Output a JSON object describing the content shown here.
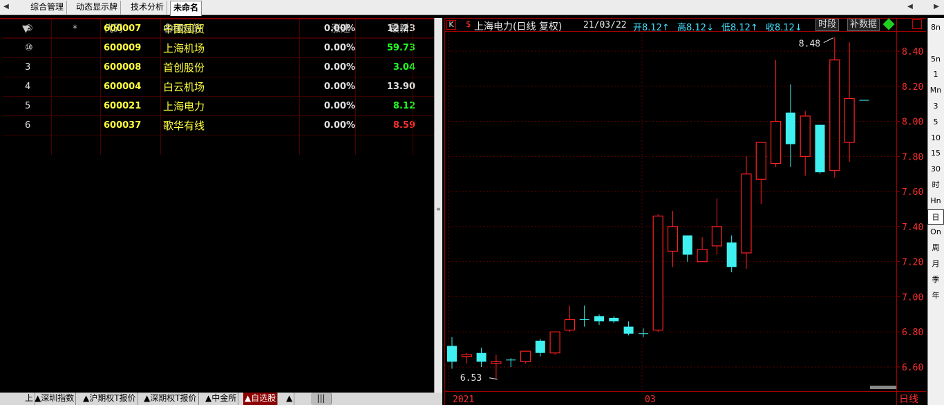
{
  "tabs": [
    "综合管理",
    "动态显示牌",
    "技术分析",
    "未命名"
  ],
  "list": {
    "headers": [
      "▼",
      "*",
      "代码",
      "名称对的",
      "涨速",
      "最新"
    ],
    "rows": [
      {
        "idx": "⑤",
        "code": "600007",
        "name": "中国国贸",
        "speed": "0.00%",
        "price": "12.23",
        "pc": "#e0e0e0"
      },
      {
        "idx": "⑩",
        "code": "600009",
        "name": "上海机场",
        "speed": "0.00%",
        "price": "59.73",
        "pc": "#20ff20"
      },
      {
        "idx": "3",
        "code": "600008",
        "name": "首创股份",
        "speed": "0.00%",
        "price": "3.04",
        "pc": "#20ff20"
      },
      {
        "idx": "4",
        "code": "600004",
        "name": "白云机场",
        "speed": "0.00%",
        "price": "13.90",
        "pc": "#e0e0e0"
      },
      {
        "idx": "5",
        "code": "600021",
        "name": "上海电力",
        "speed": "0.00%",
        "price": "8.12",
        "pc": "#20ff20"
      },
      {
        "idx": "6",
        "code": "600037",
        "name": "歌华有线",
        "speed": "0.00%",
        "price": "8.59",
        "pc": "#ff3030"
      }
    ]
  },
  "bottom_tabs": [
    "上",
    "▲深圳指数",
    "▲沪期权T报价",
    "▲深期权T报价",
    "▲中金所",
    "▲自选股",
    "▲",
    "|||"
  ],
  "chart_header": {
    "k": "K",
    "s": "$",
    "title": "上海电力(日线 复权)",
    "date": "21/03/22",
    "open": "开8.12↑",
    "high": "高8.12↓",
    "low": "低8.12↑",
    "close": "收8.12↓",
    "btn_time": "时段",
    "btn_data": "补数据"
  },
  "chart_data": {
    "type": "candlestick",
    "ylim": [
      6.53,
      8.5
    ],
    "yticks": [
      "8.40",
      "8.20",
      "8.00",
      "7.80",
      "7.60",
      "7.40",
      "7.20",
      "7.00",
      "6.80",
      "6.60"
    ],
    "xlabels": [
      "2021",
      "03"
    ],
    "period_label": "日线",
    "annotations": {
      "max": "8.48",
      "min": "6.53"
    },
    "candles": [
      {
        "o": 6.72,
        "h": 6.77,
        "l": 6.59,
        "c": 6.63
      },
      {
        "o": 6.66,
        "h": 6.68,
        "l": 6.62,
        "c": 6.67
      },
      {
        "o": 6.68,
        "h": 6.71,
        "l": 6.6,
        "c": 6.63
      },
      {
        "o": 6.62,
        "h": 6.67,
        "l": 6.53,
        "c": 6.63
      },
      {
        "o": 6.64,
        "h": 6.65,
        "l": 6.6,
        "c": 6.64
      },
      {
        "o": 6.63,
        "h": 6.69,
        "l": 6.62,
        "c": 6.69
      },
      {
        "o": 6.75,
        "h": 6.76,
        "l": 6.66,
        "c": 6.68
      },
      {
        "o": 6.68,
        "h": 6.8,
        "l": 6.67,
        "c": 6.8
      },
      {
        "o": 6.81,
        "h": 6.95,
        "l": 6.8,
        "c": 6.87
      },
      {
        "o": 6.87,
        "h": 6.95,
        "l": 6.83,
        "c": 6.87
      },
      {
        "o": 6.89,
        "h": 6.9,
        "l": 6.84,
        "c": 6.86
      },
      {
        "o": 6.88,
        "h": 6.89,
        "l": 6.85,
        "c": 6.86
      },
      {
        "o": 6.83,
        "h": 6.86,
        "l": 6.78,
        "c": 6.79
      },
      {
        "o": 6.79,
        "h": 6.82,
        "l": 6.77,
        "c": 6.79
      },
      {
        "o": 6.81,
        "h": 7.47,
        "l": 6.8,
        "c": 7.46
      },
      {
        "o": 7.26,
        "h": 7.49,
        "l": 7.17,
        "c": 7.4
      },
      {
        "o": 7.35,
        "h": 7.35,
        "l": 7.2,
        "c": 7.24
      },
      {
        "o": 7.2,
        "h": 7.34,
        "l": 7.2,
        "c": 7.27
      },
      {
        "o": 7.29,
        "h": 7.56,
        "l": 7.24,
        "c": 7.4
      },
      {
        "o": 7.31,
        "h": 7.35,
        "l": 7.14,
        "c": 7.17
      },
      {
        "o": 7.25,
        "h": 7.8,
        "l": 7.16,
        "c": 7.7
      },
      {
        "o": 7.67,
        "h": 7.88,
        "l": 7.53,
        "c": 7.88
      },
      {
        "o": 7.76,
        "h": 8.35,
        "l": 7.74,
        "c": 8.0
      },
      {
        "o": 8.05,
        "h": 8.21,
        "l": 7.74,
        "c": 7.87
      },
      {
        "o": 7.8,
        "h": 8.06,
        "l": 7.69,
        "c": 8.03
      },
      {
        "o": 7.98,
        "h": 7.98,
        "l": 7.7,
        "c": 7.71
      },
      {
        "o": 7.72,
        "h": 8.48,
        "l": 7.68,
        "c": 8.35
      },
      {
        "o": 7.88,
        "h": 8.45,
        "l": 7.77,
        "c": 8.13
      },
      {
        "o": 8.12,
        "h": 8.12,
        "l": 8.12,
        "c": 8.12
      }
    ]
  },
  "right_toolbar": [
    "8n",
    "",
    "5n",
    "1",
    "Mn",
    "3",
    "5",
    "10",
    "15",
    "30",
    "时",
    "Hn",
    "日",
    "On",
    "周",
    "月",
    "季",
    "年"
  ]
}
